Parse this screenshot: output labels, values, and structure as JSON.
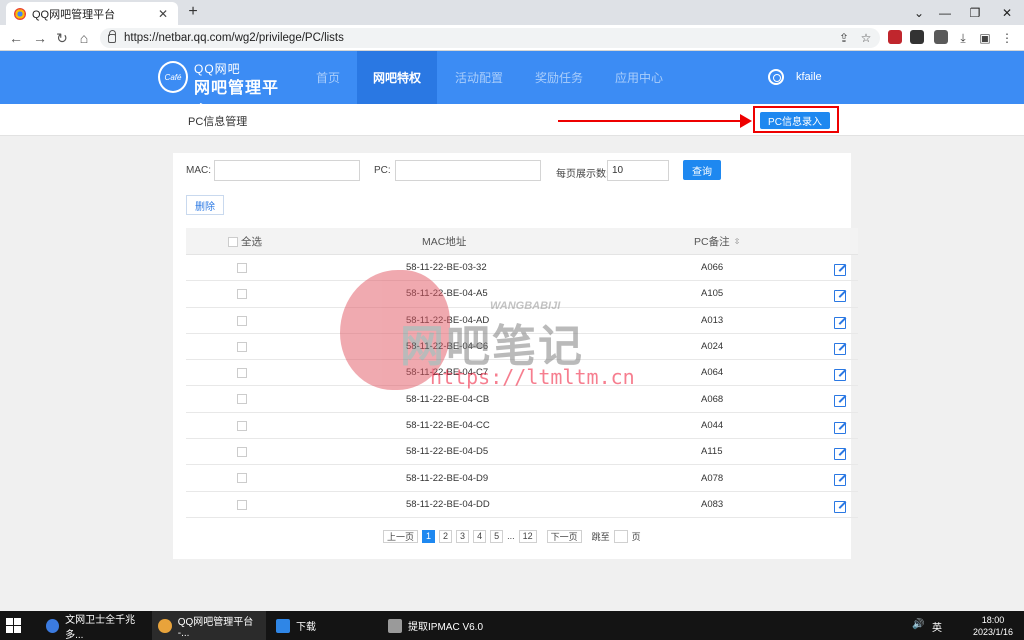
{
  "browser": {
    "tab_title": "QQ网吧管理平台",
    "tab_close": "✕",
    "new_tab": "+",
    "url": "https://netbar.qq.com/wg2/privilege/PC/lists",
    "back": "←",
    "forward": "→",
    "reload": "↻",
    "home": "⌂",
    "minimize": "—",
    "maximize": "❐",
    "close": "✕",
    "chevron": "⌄",
    "share": "⇪",
    "star": "☆",
    "download": "⤓",
    "sidepanel": "▣",
    "menu": "⋮"
  },
  "site": {
    "logo_badge": "Café",
    "logo_line1": "QQ网吧",
    "logo_line2": "网吧管理平台",
    "nav": [
      "首页",
      "网吧特权",
      "活动配置",
      "奖励任务",
      "应用中心"
    ],
    "active_nav": "网吧特权",
    "username": "kfaile"
  },
  "subheader": {
    "title": "PC信息管理",
    "entry_button": "PC信息录入"
  },
  "filters": {
    "mac_label": "MAC:",
    "mac_value": "",
    "pc_label": "PC:",
    "pc_value": "",
    "per_page_label": "每页展示数:",
    "per_page_value": "10",
    "query_button": "查询",
    "delete_button": "删除"
  },
  "table": {
    "col_select_all": "全选",
    "col_mac": "MAC地址",
    "col_pc": "PC备注",
    "sort_icon": "⇳",
    "rows": [
      {
        "mac": "58-11-22-BE-03-32",
        "pc": "A066"
      },
      {
        "mac": "58-11-22-BE-04-A5",
        "pc": "A105"
      },
      {
        "mac": "58-11-22-BE-04-AD",
        "pc": "A013"
      },
      {
        "mac": "58-11-22-BE-04-C6",
        "pc": "A024"
      },
      {
        "mac": "58-11-22-BE-04-C7",
        "pc": "A064"
      },
      {
        "mac": "58-11-22-BE-04-CB",
        "pc": "A068"
      },
      {
        "mac": "58-11-22-BE-04-CC",
        "pc": "A044"
      },
      {
        "mac": "58-11-22-BE-04-D5",
        "pc": "A115"
      },
      {
        "mac": "58-11-22-BE-04-D9",
        "pc": "A078"
      },
      {
        "mac": "58-11-22-BE-04-DD",
        "pc": "A083"
      }
    ]
  },
  "pager": {
    "prev": "上一页",
    "pages": [
      "1",
      "2",
      "3",
      "4",
      "5"
    ],
    "current": "1",
    "ellipsis": "...",
    "last": "12",
    "next": "下一页",
    "jump_to": "跳至",
    "page_suffix": "页"
  },
  "watermark": {
    "en": "WANGBABIJI",
    "cn": "网吧笔记",
    "url": "https://ltmltm.cn"
  },
  "taskbar": {
    "tasks": [
      "文网卫士全千兆多...",
      "QQ网吧管理平台 -...",
      "下载",
      "提取IPMAC V6.0"
    ],
    "tray_lang": "英",
    "tray_volume": "🔊",
    "time": "18:00",
    "date": "2023/1/16"
  },
  "colors": {
    "header_blue": "#3c8cf4",
    "active_nav": "#2a78e3",
    "button_blue": "#1e88f0",
    "highlight_red": "#e00000"
  }
}
